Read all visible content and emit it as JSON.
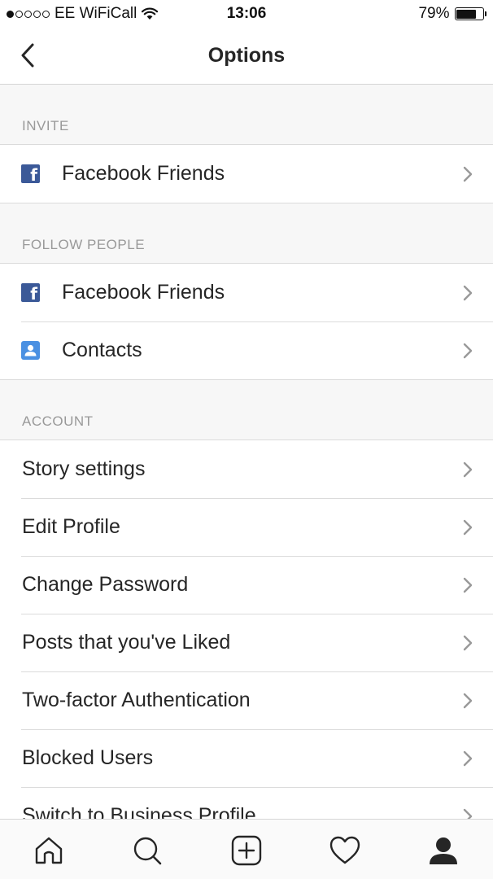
{
  "status_bar": {
    "carrier": "EE WiFiCall",
    "time": "13:06",
    "battery_percent": "79%",
    "battery_level": 0.79,
    "signal_bars_filled": 1,
    "signal_bars_total": 5
  },
  "nav": {
    "title": "Options",
    "back_icon": "chevron-left-icon"
  },
  "sections": {
    "invite": {
      "header": "INVITE",
      "items": [
        {
          "label": "Facebook Friends",
          "icon": "facebook-icon"
        }
      ]
    },
    "follow_people": {
      "header": "FOLLOW PEOPLE",
      "items": [
        {
          "label": "Facebook Friends",
          "icon": "facebook-icon"
        },
        {
          "label": "Contacts",
          "icon": "contacts-icon"
        }
      ]
    },
    "account": {
      "header": "ACCOUNT",
      "items": [
        {
          "label": "Story settings"
        },
        {
          "label": "Edit Profile"
        },
        {
          "label": "Change Password"
        },
        {
          "label": "Posts that you've Liked"
        },
        {
          "label": "Two-factor Authentication"
        },
        {
          "label": "Blocked Users"
        },
        {
          "label": "Switch to Business Profile"
        }
      ]
    }
  },
  "tab_bar": {
    "tabs": [
      {
        "name": "home",
        "icon": "home-icon"
      },
      {
        "name": "search",
        "icon": "search-icon"
      },
      {
        "name": "new-post",
        "icon": "plus-square-icon"
      },
      {
        "name": "activity",
        "icon": "heart-icon"
      },
      {
        "name": "profile",
        "icon": "person-icon",
        "active": true
      }
    ]
  },
  "colors": {
    "background": "#f7f7f7",
    "separator": "#dbdbdb",
    "section_header_text": "#999999",
    "facebook_blue": "#3b5998",
    "contacts_blue": "#4a90e2"
  }
}
